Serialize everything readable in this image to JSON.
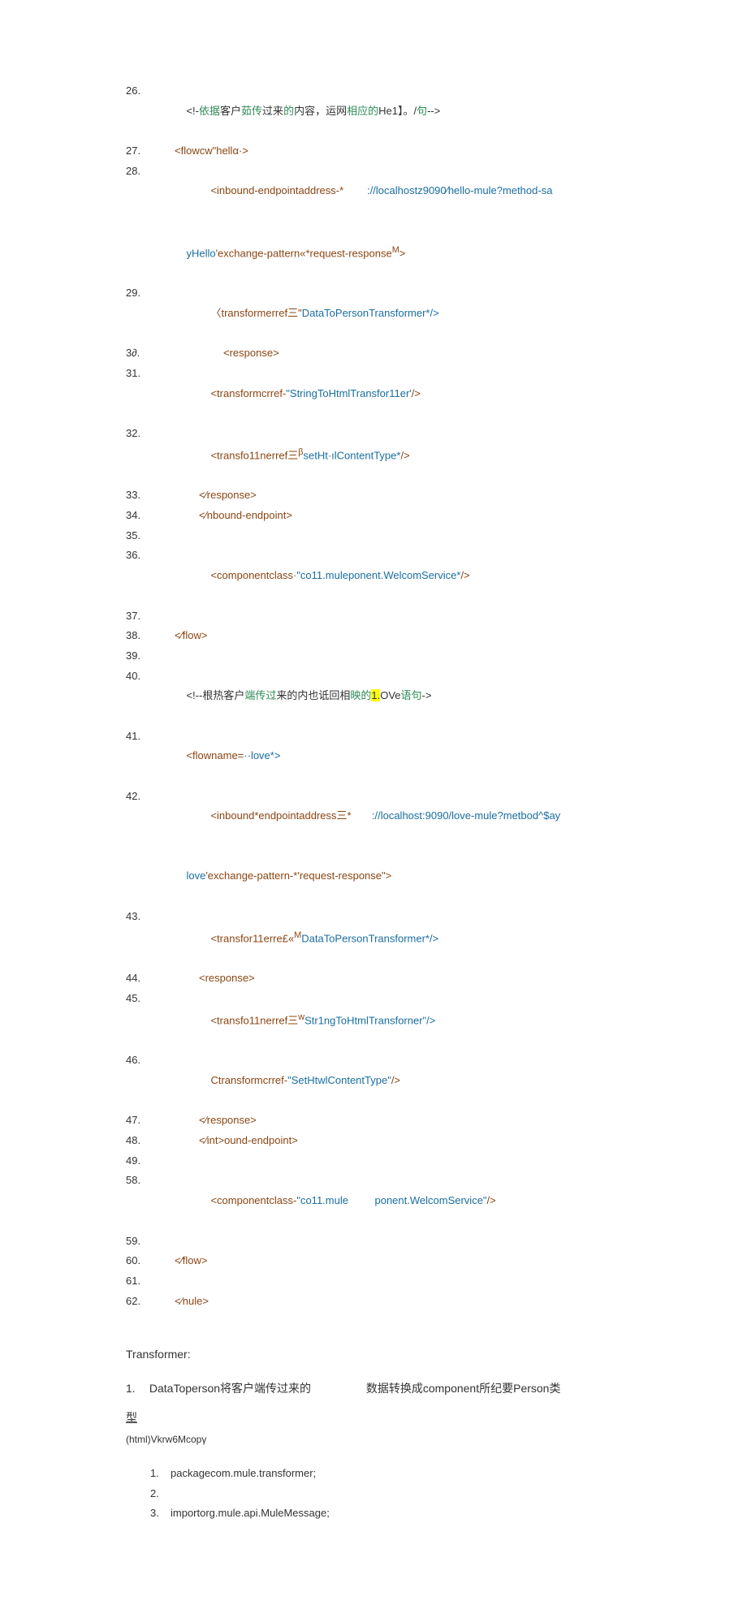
{
  "lines": {
    "26": {
      "n": "26.",
      "pre": "<!-",
      "g1": "依据",
      "mid1": "客户",
      "g2": "茹传",
      "mid2": "过来",
      "g3": "的",
      "mid3": "内容，运网",
      "g4": "相应的",
      "mid4": "He1】。/",
      "g5": "句",
      "post": "-->"
    },
    "27": {
      "n": "27.",
      "t": "<flowcw\"hellα·>"
    },
    "28": {
      "n": "28.",
      "a": "<inbound-endpointaddress-*",
      "gap": "        ",
      "b": "://localhostz9090⁄hello-mule?method-sa"
    },
    "28b": {
      "t": "yHello",
      "br": "'exchange-pattern«*request-response",
      "sup": "M",
      "end": ">"
    },
    "29": {
      "n": "29.",
      "a": "〈transformerref",
      "b": "三\"",
      "c": "DataToPersonTransformer*/>"
    },
    "30": {
      "n": "3∂.",
      "t": "<response>"
    },
    "31": {
      "n": "31.",
      "a": "<transformcrref-",
      "b": "\"StringToHtmlTransfor11er'",
      "c": "/>"
    },
    "32": {
      "n": "32.",
      "a": "<transfo11nerref",
      "b": "三",
      "sup": "β",
      "c": "setHt·ılContentType*",
      "d": "/>"
    },
    "33": {
      "n": "33.",
      "t": "<⁄response>"
    },
    "34": {
      "n": "34.",
      "t": "<⁄nbound-endpoint>"
    },
    "35": {
      "n": "35."
    },
    "36": {
      "n": "36.",
      "a": "<componentclass",
      "b": "·\"co11.muleponent.WelcomService*",
      "c": "/>"
    },
    "37": {
      "n": "37."
    },
    "38": {
      "n": "38.",
      "t": "<⁄flow>"
    },
    "39": {
      "n": "39."
    },
    "40": {
      "n": "40.",
      "pre": "<!--根热客户",
      "g1": "端传过",
      "mid": "来的内也诋回相",
      "g2": "映的",
      "hl": "1.",
      "g3": "OVe",
      "g4": "语句",
      "post": "->"
    },
    "41": {
      "n": "41.",
      "a": "<flowname=",
      "b": "··love*>"
    },
    "42": {
      "n": "42.",
      "a": "<inbound*endpointaddress",
      "b": "三*",
      "gap": "       ",
      "c": "://localhost:9090/love-mule?metbod^$ay"
    },
    "42b": {
      "a": "love",
      "b": "'exchange-pattern-*'request-response\">"
    },
    "43": {
      "n": "43.",
      "a": "<transfor11erre£«",
      "sup": "M",
      "b": "DataToPersonTransformer*/>"
    },
    "44": {
      "n": "44.",
      "t": "<response>"
    },
    "45": {
      "n": "45.",
      "a": "<transfo11nerref",
      "b": "三",
      "sup": "w",
      "c": "Str1ngToHtmlTransforner\"/>"
    },
    "46": {
      "n": "46.",
      "a": "Ctransformcrref-",
      "b": "\"SetHtwlContentType\"",
      "c": "/>"
    },
    "47": {
      "n": "47.",
      "t": "<⁄response>"
    },
    "48": {
      "n": "48.",
      "t": "<⁄int>ound-endpoint>"
    },
    "49": {
      "n": "49."
    },
    "58": {
      "n": "58.",
      "a": "<componentclass-",
      "b": "\"co11.mule",
      "gap": "         ",
      "c": "ponent.WelcomService\"",
      "d": "/>"
    },
    "59": {
      "n": "59."
    },
    "60": {
      "n": "60.",
      "t": "<⁄flow>"
    },
    "61": {
      "n": "61."
    },
    "62": {
      "n": "62.",
      "t": "<⁄nule>"
    }
  },
  "transformer_title": "Transformer:",
  "para_num": "1.",
  "para_a": "DataToperson将客户端传过来的",
  "para_b": "数据转换成component所纪要Person类",
  "para_c": "型",
  "note": "(html)Vkrw6Mcopγ",
  "small": {
    "1": {
      "n": "1.",
      "t": "packagecom.mule.transformer;"
    },
    "2": {
      "n": "2."
    },
    "3": {
      "n": "3.",
      "t": "importorg.mule.api.MuleMessage;"
    }
  }
}
